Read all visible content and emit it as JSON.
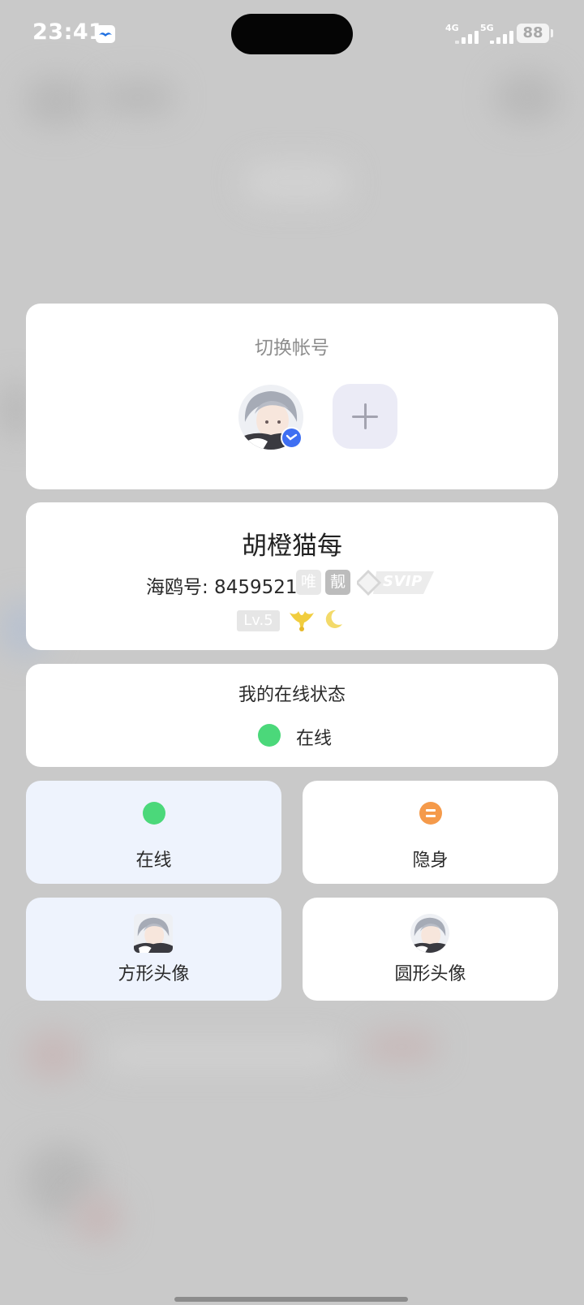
{
  "status_bar": {
    "time": "23:41",
    "network_1": "4G",
    "network_2": "5G",
    "battery": "88"
  },
  "switch_account": {
    "title": "切换帐号",
    "accounts": [
      {
        "avatar": "anime-boy-avatar",
        "verified_icon": "checkmark-badge-icon"
      }
    ],
    "add_icon": "plus-icon"
  },
  "profile": {
    "nickname": "胡橙猫每",
    "id_label": "海鸥号: 8459521",
    "badge_1": "唯",
    "badge_2": "靓",
    "svip_label": "SVIP",
    "level": "Lv.5",
    "level_icons": [
      "crown-icon",
      "moon-icon"
    ]
  },
  "online_status": {
    "title": "我的在线状态",
    "current_value": "在线",
    "current_color": "#4bd87a"
  },
  "options": {
    "online": {
      "label": "在线",
      "color": "#4bd87a",
      "selected": true
    },
    "invisible": {
      "label": "隐身",
      "color": "#f59a4a",
      "selected": false
    },
    "square_avatar": {
      "label": "方形头像",
      "selected": true
    },
    "round_avatar": {
      "label": "圆形头像",
      "selected": false
    }
  },
  "colors": {
    "selected_bg": "#eef3fd",
    "badge_blue": "#3f6ff2"
  }
}
